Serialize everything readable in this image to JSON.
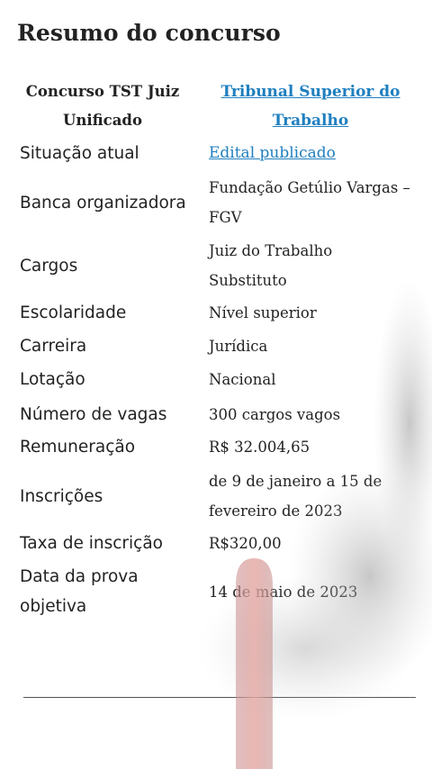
{
  "title": "Resumo do concurso",
  "header": {
    "left": "Concurso TST Juiz Unificado",
    "right": "Tribunal Superior do Trabalho"
  },
  "rows": [
    {
      "label": "Situação atual",
      "value": "Edital publicado",
      "link": true
    },
    {
      "label": "Banca organizadora",
      "value": "Fundação Getúlio Vargas – FGV"
    },
    {
      "label": "Cargos",
      "value": "Juiz do Trabalho Substituto"
    },
    {
      "label": "Escolaridade",
      "value": "Nível superior"
    },
    {
      "label": "Carreira",
      "value": "Jurídica"
    },
    {
      "label": "Lotação",
      "value": "Nacional"
    },
    {
      "label": "Número de vagas",
      "value": "300 cargos vagos"
    },
    {
      "label": "Remuneração",
      "value": "R$ 32.004,65"
    },
    {
      "label": "Inscrições",
      "value": "de 9 de janeiro a 15 de fevereiro de 2023"
    },
    {
      "label": "Taxa de inscrição",
      "value": "R$320,00"
    },
    {
      "label": "Data da prova objetiva",
      "value": "14 de maio de 2023"
    }
  ]
}
